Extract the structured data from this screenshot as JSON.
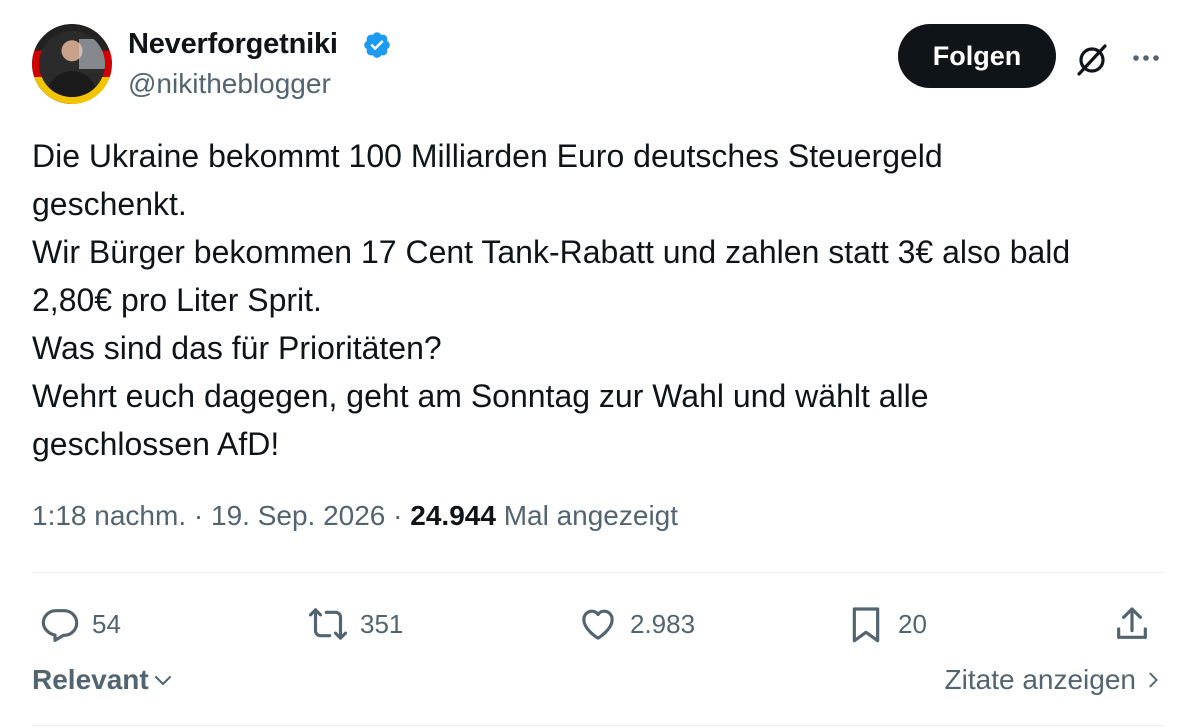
{
  "author": {
    "display_name": "Neverforgetniki",
    "handle": "@nikitheblogger",
    "verified": true
  },
  "header": {
    "follow_label": "Folgen"
  },
  "tweet": {
    "text": "Die Ukraine bekommt 100 Milliarden Euro deutsches Steuergeld\ngeschenkt.\nWir Bürger bekommen 17 Cent Tank-Rabatt und zahlen statt 3€ also bald\n2,80€ pro Liter Sprit.\nWas sind das für Prioritäten?\nWehrt euch dagegen, geht am Sonntag zur Wahl und wählt alle\ngeschlossen AfD!",
    "time": "1:18 nachm.",
    "date": "19. Sep. 2026",
    "views_count": "24.944",
    "views_label": "Mal angezeigt"
  },
  "actions": {
    "replies": "54",
    "reposts": "351",
    "likes": "2.983",
    "bookmarks": "20"
  },
  "footer": {
    "sort_label": "Relevant",
    "quotes_label": "Zitate anzeigen"
  },
  "icons": {
    "verified": "verified-badge-icon",
    "grok": "grok-icon",
    "more": "more-icon",
    "reply": "reply-icon",
    "repost": "repost-icon",
    "like": "heart-icon",
    "bookmark": "bookmark-icon",
    "share": "share-icon",
    "chevron_down": "chevron-down-icon",
    "chevron_right": "chevron-right-icon"
  },
  "colors": {
    "text_primary": "#0f1419",
    "text_secondary": "#536471",
    "verified_blue": "#1d9bf0",
    "button_bg": "#0f1419",
    "divider": "#eff3f4"
  }
}
